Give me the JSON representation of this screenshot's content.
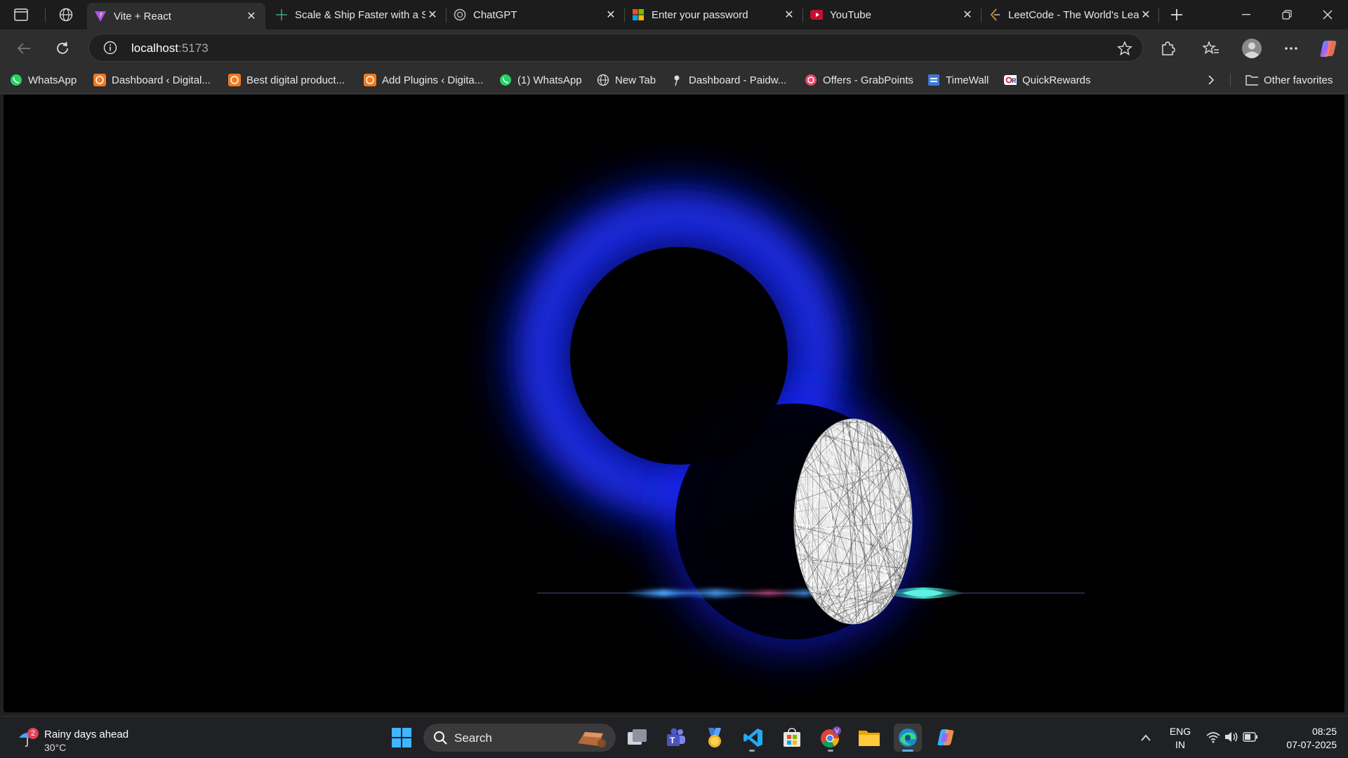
{
  "browser": {
    "tabs": [
      {
        "title": "Vite + React",
        "active": true,
        "favicon": "vite-logo-icon"
      },
      {
        "title": "Scale & Ship Faster with a Serverless Cloud",
        "active": false,
        "favicon": "app-logo-icon"
      },
      {
        "title": "ChatGPT",
        "active": false,
        "favicon": "chatgpt-icon"
      },
      {
        "title": "Enter your password",
        "active": false,
        "favicon": "microsoft-icon"
      },
      {
        "title": "YouTube",
        "active": false,
        "favicon": "youtube-icon"
      },
      {
        "title": "LeetCode - The World's Leading Online Programming Learning Platform",
        "active": false,
        "favicon": "leetcode-icon"
      }
    ],
    "address": {
      "host": "localhost",
      "port": ":5173"
    },
    "favorites": [
      {
        "label": "WhatsApp",
        "icon": "whatsapp-icon"
      },
      {
        "label": "Dashboard ‹ Digital...",
        "icon": "wordpress-orange-icon"
      },
      {
        "label": "Best digital product...",
        "icon": "wordpress-orange-icon"
      },
      {
        "label": "Add Plugins ‹ Digita...",
        "icon": "wordpress-orange-icon"
      },
      {
        "label": "(1) WhatsApp",
        "icon": "whatsapp-icon"
      },
      {
        "label": "New Tab",
        "icon": "globe-icon"
      },
      {
        "label": "Dashboard - Paidw...",
        "icon": "pin-icon"
      },
      {
        "label": "Offers - GrabPoints",
        "icon": "grabpoints-icon"
      },
      {
        "label": "TimeWall",
        "icon": "timewall-icon"
      },
      {
        "label": "QuickRewards",
        "icon": "quickrewards-icon"
      }
    ],
    "other_favorites": "Other favorites"
  },
  "taskbar": {
    "weather": {
      "badge": "2",
      "headline": "Rainy days ahead",
      "temp": "30°C"
    },
    "search_label": "Search",
    "language": {
      "line1": "ENG",
      "line2": "IN"
    },
    "clock": {
      "time": "08:25",
      "date": "07-07-2025"
    }
  },
  "colors": {
    "glow": "#1a2bff",
    "wave_cyan": "#3fe0d0",
    "wave_pink": "#e0508c"
  }
}
